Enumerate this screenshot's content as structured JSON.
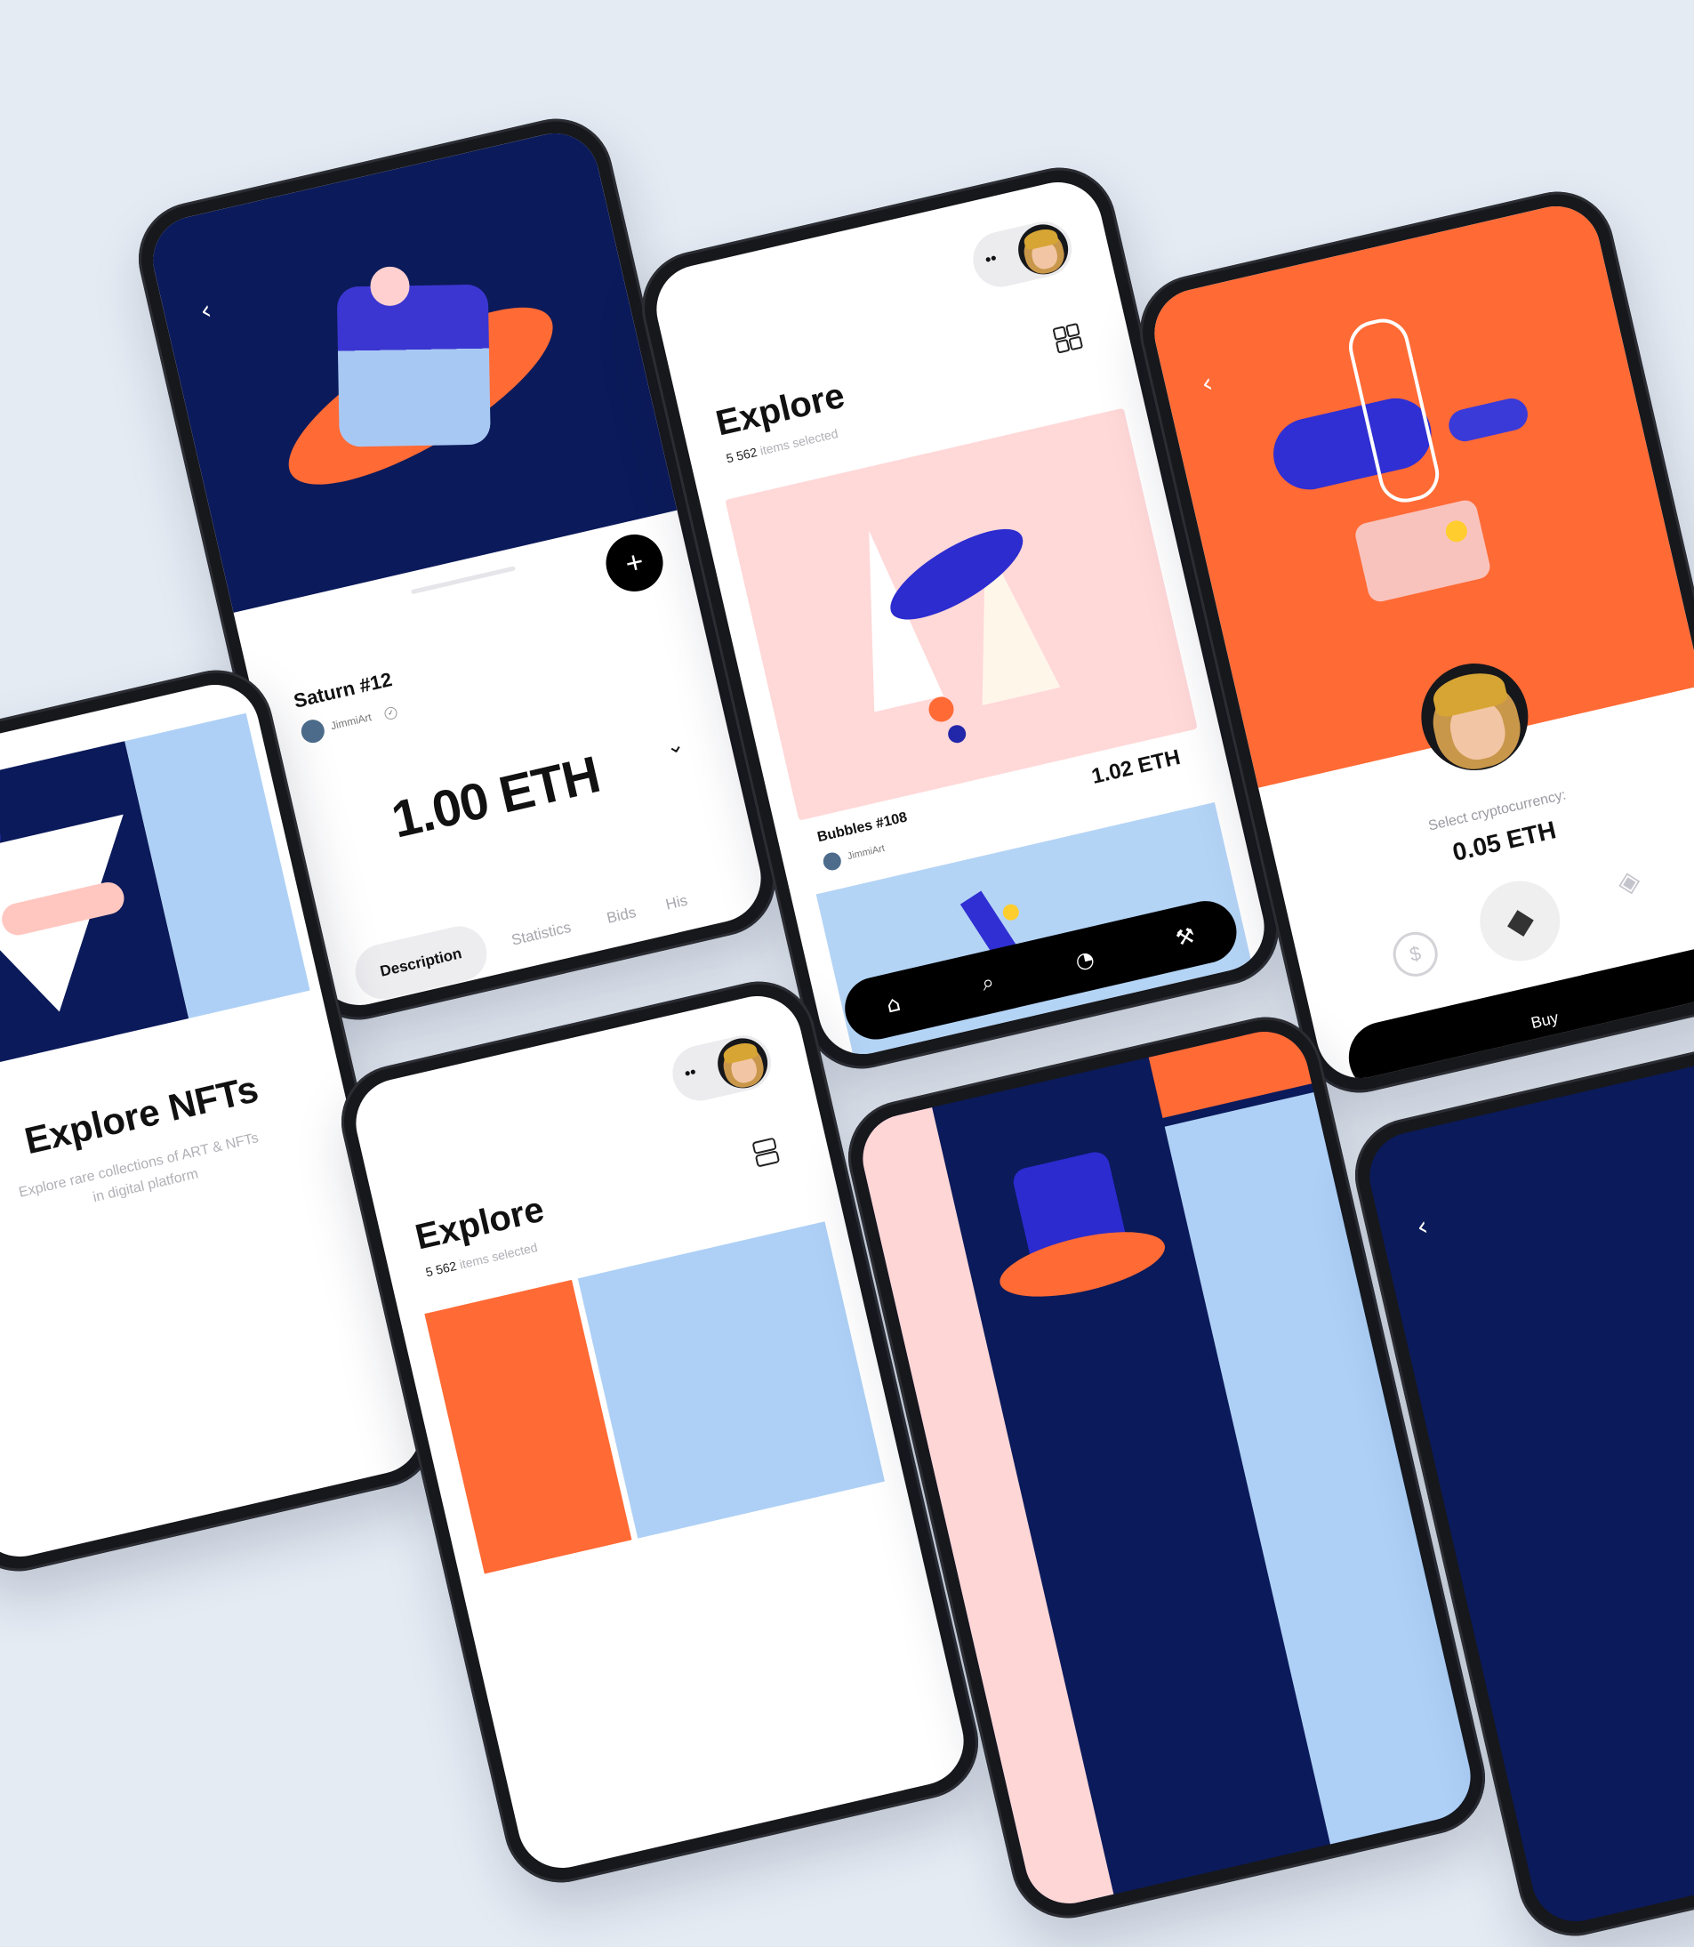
{
  "detail": {
    "back": "‹",
    "title": "Saturn #12",
    "creator": "JimmiArt",
    "price": "1.00 ETH",
    "add": "+",
    "tabs": [
      "Description",
      "Statistics",
      "Bids",
      "His"
    ]
  },
  "explore": {
    "title": "Explore",
    "count": "5 562",
    "count_label": "items selected",
    "item_name": "Bubbles #108",
    "item_creator": "JimmiArt",
    "item_price": "1.02 ETH"
  },
  "buy": {
    "back": "‹",
    "select_label": "Select cryptocurrency:",
    "amount": "0.05 ETH",
    "buy_label": "Buy"
  },
  "onboarding": {
    "title": "Explore NFTs",
    "subtitle_line1": "Explore rare collections of ART & NFTs",
    "subtitle_line2": "in digital platform"
  },
  "explore2": {
    "title": "Explore",
    "count": "5 562",
    "count_label": "items selected"
  },
  "partial": {
    "back": "‹"
  },
  "colors": {
    "navy": "#0b1a5a",
    "orange": "#ff6a35",
    "pink": "#ffd6d6",
    "light_blue": "#aed0f6",
    "background": "#e4ebf3",
    "black": "#000000"
  }
}
